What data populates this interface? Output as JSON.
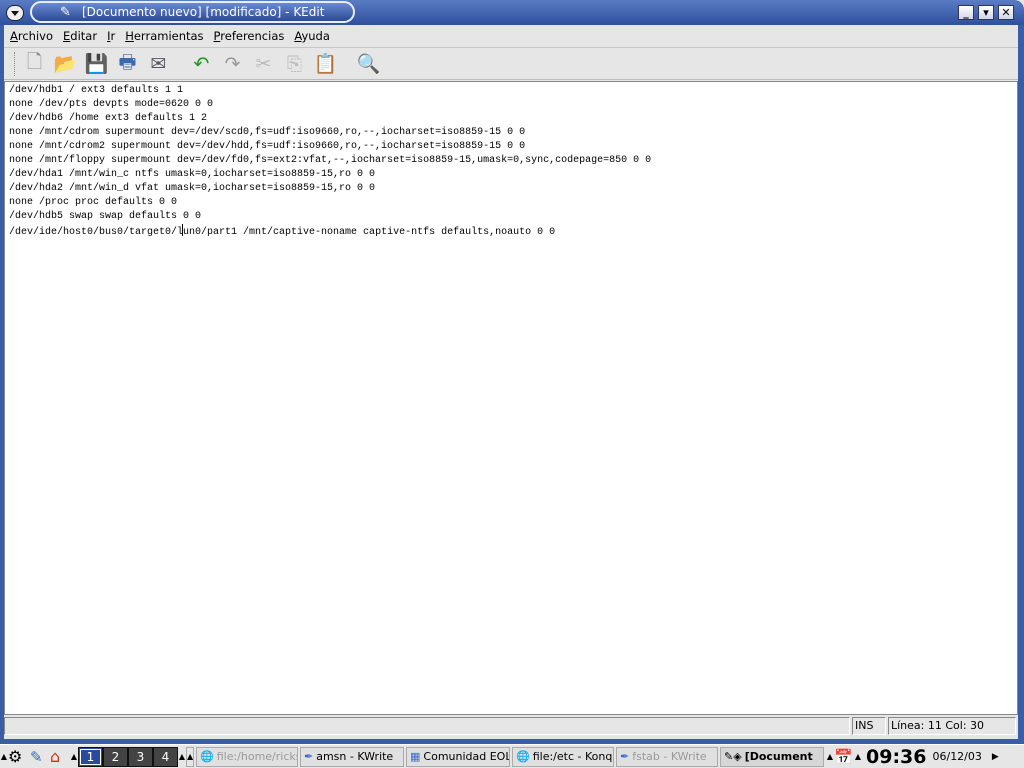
{
  "window": {
    "title": "[Documento nuevo] [modificado] - KEdit",
    "buttons": [
      "minimize",
      "maximize",
      "close"
    ]
  },
  "menu": [
    {
      "label": "Archivo",
      "u": "A",
      "rest": "rchivo"
    },
    {
      "label": "Editar",
      "u": "E",
      "rest": "ditar"
    },
    {
      "label": "Ir",
      "u": "I",
      "rest": "r"
    },
    {
      "label": "Herramientas",
      "u": "H",
      "rest": "erramientas"
    },
    {
      "label": "Preferencias",
      "u": "P",
      "rest": "referencias"
    },
    {
      "label": "Ayuda",
      "u": "y",
      "pre": "A",
      "rest": "uda"
    }
  ],
  "toolbar": [
    {
      "icon": "new-document-icon",
      "glyph": "🗋",
      "color": "#888"
    },
    {
      "icon": "open-folder-icon",
      "glyph": "📂",
      "color": "#2a6ad0"
    },
    {
      "icon": "save-icon",
      "glyph": "💾",
      "color": "#445"
    },
    {
      "icon": "print-icon",
      "glyph": "🖶",
      "color": "#3a6ab0"
    },
    {
      "icon": "send-mail-icon",
      "glyph": "✉",
      "color": "#556"
    },
    {
      "icon": "undo-icon",
      "glyph": "↶",
      "color": "#1a9a1a"
    },
    {
      "icon": "redo-icon",
      "glyph": "↷",
      "color": "#999"
    },
    {
      "icon": "cut-icon",
      "glyph": "✂",
      "color": "#bbb"
    },
    {
      "icon": "copy-icon",
      "glyph": "⎘",
      "color": "#bbb"
    },
    {
      "icon": "paste-icon",
      "glyph": "📋",
      "color": "#c09020"
    },
    {
      "icon": "find-icon",
      "glyph": "🔍",
      "color": "#3a7ad0"
    }
  ],
  "editor": {
    "lines": [
      "/dev/hdb1 / ext3 defaults 1 1",
      "none /dev/pts devpts mode=0620 0 0",
      "/dev/hdb6 /home ext3 defaults 1 2",
      "none /mnt/cdrom supermount dev=/dev/scd0,fs=udf:iso9660,ro,--,iocharset=iso8859-15 0 0",
      "none /mnt/cdrom2 supermount dev=/dev/hdd,fs=udf:iso9660,ro,--,iocharset=iso8859-15 0 0",
      "none /mnt/floppy supermount dev=/dev/fd0,fs=ext2:vfat,--,iocharset=iso8859-15,umask=0,sync,codepage=850 0 0",
      "/dev/hda1 /mnt/win_c ntfs umask=0,iocharset=iso8859-15,ro 0 0",
      "/dev/hda2 /mnt/win_d vfat umask=0,iocharset=iso8859-15,ro 0 0",
      "none /proc proc defaults 0 0",
      "/dev/hdb5 swap swap defaults 0 0",
      "/dev/ide/host0/bus0/target0/lun0/part1 /mnt/captive-noname captive-ntfs defaults,noauto 0 0"
    ]
  },
  "status": {
    "message": "",
    "mode": "INS",
    "position": "Línea: 11 Col: 30"
  },
  "taskbar": {
    "desktops": [
      "1",
      "2",
      "3",
      "4"
    ],
    "active_desktop": "1",
    "tasks": [
      {
        "label": "file:/home/ricks/",
        "dim": true,
        "glyph": "🌐"
      },
      {
        "label": "amsn - KWrite",
        "dim": false,
        "glyph": "✒"
      },
      {
        "label": "Comunidad EOL",
        "dim": false,
        "glyph": "▦"
      },
      {
        "label": "file:/etc - Konqu",
        "dim": false,
        "glyph": "🌐"
      },
      {
        "label": "fstab - KWrite",
        "dim": true,
        "glyph": "✒"
      }
    ],
    "active_task": "[Document",
    "clock": "09:36",
    "date": "06/12/03"
  }
}
